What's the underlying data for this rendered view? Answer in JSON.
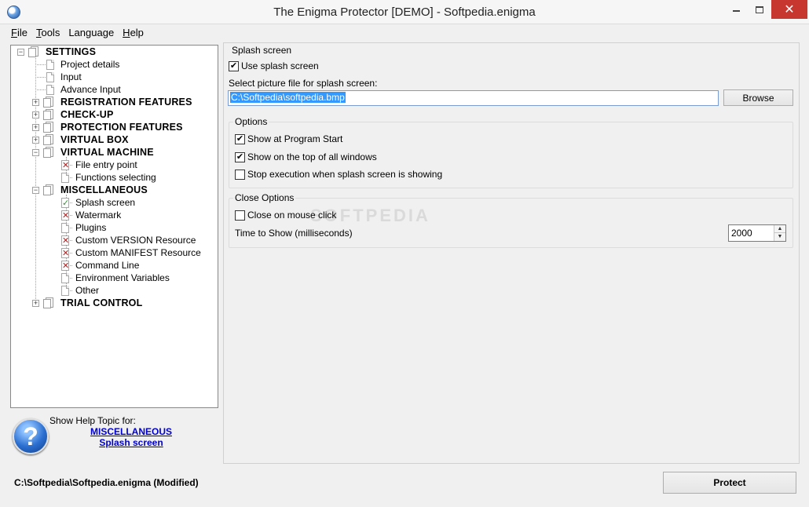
{
  "window": {
    "title": "The Enigma Protector [DEMO] - Softpedia.enigma",
    "close_glyph": "✕"
  },
  "menu": [
    {
      "label": "File",
      "accel": "F",
      "rest": "ile"
    },
    {
      "label": "Tools",
      "accel": "T",
      "rest": "ools"
    },
    {
      "label": "Language",
      "accel": "",
      "rest": "Language"
    },
    {
      "label": "Help",
      "accel": "H",
      "rest": "elp"
    }
  ],
  "tree": {
    "settings": "SETTINGS",
    "project_details": "Project details",
    "input": "Input",
    "advance_input": "Advance Input",
    "registration_features": "REGISTRATION FEATURES",
    "check_up": "CHECK-UP",
    "protection_features": "PROTECTION FEATURES",
    "virtual_box": "VIRTUAL BOX",
    "virtual_machine": "VIRTUAL MACHINE",
    "file_entry_point": "File entry point",
    "functions_selecting": "Functions selecting",
    "miscellaneous": "MISCELLANEOUS",
    "splash_screen": "Splash screen",
    "watermark": "Watermark",
    "plugins": "Plugins",
    "custom_version_resource": "Custom VERSION Resource",
    "custom_manifest_resource": "Custom MANIFEST Resource",
    "command_line": "Command Line",
    "environment_variables": "Environment Variables",
    "other": "Other",
    "trial_control": "TRIAL CONTROL"
  },
  "help": {
    "caption": "Show Help Topic for:",
    "link_section": "MISCELLANEOUS",
    "link_topic": "Splash screen",
    "icon_glyph": "?"
  },
  "splash": {
    "group_title": "Splash screen",
    "use_splash_label": "Use splash screen",
    "use_splash_checked": true,
    "select_label": "Select picture file for splash screen:",
    "file_path": "C:\\Softpedia\\softpedia.bmp",
    "browse_label": "Browse"
  },
  "options": {
    "group_title": "Options",
    "show_at_start_label": "Show at Program Start",
    "show_at_start_checked": true,
    "show_on_top_label": "Show on the top of all windows",
    "show_on_top_checked": true,
    "stop_execution_label": "Stop execution when splash screen is showing",
    "stop_execution_checked": false
  },
  "close_options": {
    "group_title": "Close Options",
    "close_on_click_label": "Close on mouse click",
    "close_on_click_checked": false,
    "time_label": "Time to Show (milliseconds)",
    "time_value": "2000"
  },
  "status": {
    "project_path": "C:\\Softpedia\\Softpedia.enigma  (Modified)",
    "protect_label": "Protect"
  },
  "watermark_text": "SOFTPEDIA",
  "glyphs": {
    "check": "✔",
    "x_mark": "✕",
    "ok_mark": "✓",
    "plus": "+",
    "minus": "−",
    "spin_up": "▲",
    "spin_down": "▼"
  }
}
